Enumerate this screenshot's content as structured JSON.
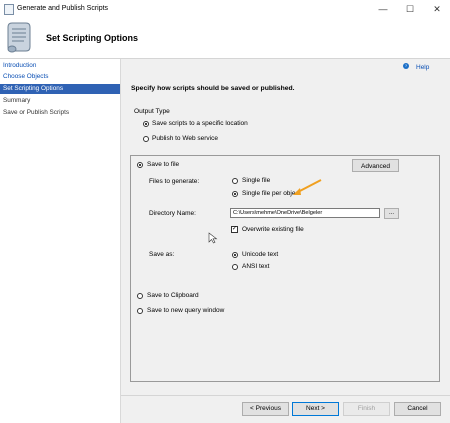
{
  "window": {
    "title": "Generate and Publish Scripts",
    "minimize": "—",
    "maximize": "☐",
    "close": "✕"
  },
  "header": {
    "title": "Set Scripting Options"
  },
  "sidebar": {
    "items": [
      {
        "label": "Introduction"
      },
      {
        "label": "Choose Objects"
      },
      {
        "label": "Set Scripting Options"
      },
      {
        "label": "Summary"
      },
      {
        "label": "Save or Publish Scripts"
      }
    ]
  },
  "help": {
    "label": "Help",
    "icon": "?"
  },
  "main": {
    "instruction": "Specify how scripts should be saved or published.",
    "output_type": {
      "label": "Output Type",
      "options": [
        "Save scripts to a specific location",
        "Publish to Web service"
      ],
      "selected": 0
    },
    "save_to_file": {
      "label": "Save to file",
      "advanced": "Advanced",
      "files_to_generate_label": "Files to generate:",
      "files_options": [
        "Single file",
        "Single file per object"
      ],
      "files_selected": 1,
      "directory_label": "Directory Name:",
      "directory_value": "C:\\Users\\mehme\\OneDrive\\Belgeler",
      "browse": "...",
      "overwrite_label": "Overwrite existing file",
      "overwrite_checked": true,
      "save_as_label": "Save as:",
      "save_as_options": [
        "Unicode text",
        "ANSI text"
      ],
      "save_as_selected": 0
    },
    "save_to_clipboard": "Save to Clipboard",
    "save_to_query_window": "Save to new query window"
  },
  "footer": {
    "previous": "< Previous",
    "next": "Next >",
    "finish": "Finish",
    "cancel": "Cancel"
  },
  "colors": {
    "accent": "#2f62b4",
    "link": "#0a4fb4",
    "annotation_arrow": "#f0a020"
  }
}
